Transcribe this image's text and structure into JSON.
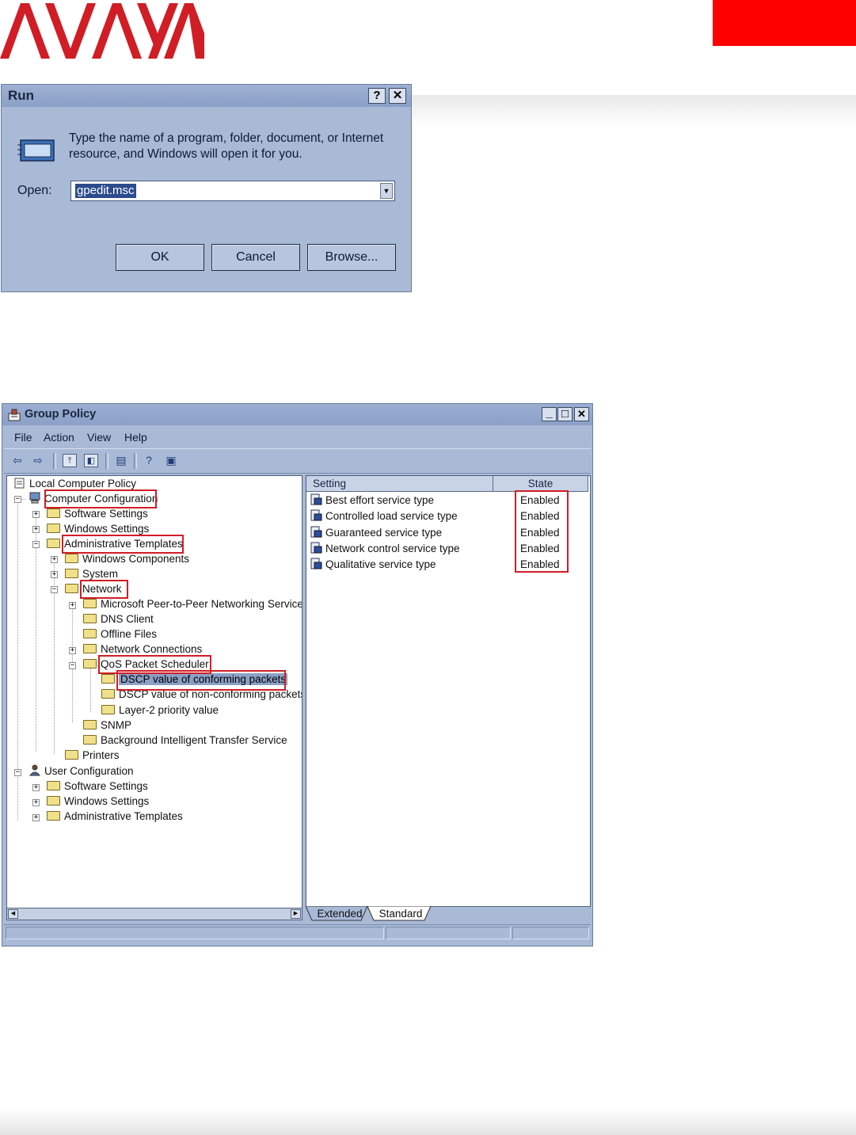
{
  "brand": {
    "logo_text": "AVAYA",
    "logo_color": "#d11d25",
    "accent_block_color": "#ff0000"
  },
  "run_dialog": {
    "title": "Run",
    "help_button": "?",
    "close_button": "✕",
    "prompt": "Type the name of a program, folder, document, or Internet resource, and Windows will open it for you.",
    "open_label": "Open:",
    "open_value": "gpedit.msc",
    "buttons": {
      "ok": "OK",
      "cancel": "Cancel",
      "browse": "Browse..."
    }
  },
  "group_policy": {
    "title": "Group Policy",
    "window_buttons": {
      "minimize": "_",
      "maximize": "□",
      "close": "✕"
    },
    "menu": [
      "File",
      "Action",
      "View",
      "Help"
    ],
    "tree": [
      {
        "label": "Local Computer Policy",
        "icon": "policy-icon"
      },
      {
        "label": "Computer Configuration",
        "icon": "computer-icon",
        "highlighted": true
      },
      {
        "label": "Software Settings",
        "icon": "folder-icon"
      },
      {
        "label": "Windows Settings",
        "icon": "folder-icon"
      },
      {
        "label": "Administrative Templates",
        "icon": "folder-icon",
        "highlighted": true
      },
      {
        "label": "Windows Components",
        "icon": "folder-icon"
      },
      {
        "label": "System",
        "icon": "folder-icon"
      },
      {
        "label": "Network",
        "icon": "folder-icon",
        "highlighted": true
      },
      {
        "label": "Microsoft Peer-to-Peer Networking Services",
        "icon": "folder-icon"
      },
      {
        "label": "DNS Client",
        "icon": "folder-icon"
      },
      {
        "label": "Offline Files",
        "icon": "folder-icon"
      },
      {
        "label": "Network Connections",
        "icon": "folder-icon"
      },
      {
        "label": "QoS Packet Scheduler",
        "icon": "folder-icon",
        "highlighted": true
      },
      {
        "label": "DSCP value of conforming packets",
        "icon": "folder-icon",
        "highlighted": true,
        "selected": true
      },
      {
        "label": "DSCP value of non-conforming packets",
        "icon": "folder-icon"
      },
      {
        "label": "Layer-2 priority value",
        "icon": "folder-icon"
      },
      {
        "label": "SNMP",
        "icon": "folder-icon"
      },
      {
        "label": "Background Intelligent Transfer Service",
        "icon": "folder-icon"
      },
      {
        "label": "Printers",
        "icon": "folder-icon"
      },
      {
        "label": "User Configuration",
        "icon": "user-icon"
      },
      {
        "label": "Software Settings",
        "icon": "folder-icon"
      },
      {
        "label": "Windows Settings",
        "icon": "folder-icon"
      },
      {
        "label": "Administrative Templates",
        "icon": "folder-icon"
      }
    ],
    "list": {
      "columns": [
        "Setting",
        "State"
      ],
      "rows": [
        {
          "setting": "Best effort service type",
          "state": "Enabled"
        },
        {
          "setting": "Controlled load service type",
          "state": "Enabled"
        },
        {
          "setting": "Guaranteed service type",
          "state": "Enabled"
        },
        {
          "setting": "Network control service type",
          "state": "Enabled"
        },
        {
          "setting": "Qualitative service type",
          "state": "Enabled"
        }
      ]
    },
    "tabs": [
      "Extended",
      "Standard"
    ],
    "active_tab": "Standard",
    "highlight_color": "#d11d25"
  }
}
